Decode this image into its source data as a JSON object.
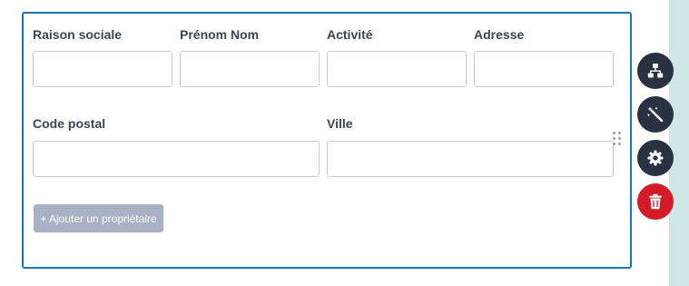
{
  "form": {
    "fields": {
      "raison_sociale": {
        "label": "Raison sociale",
        "value": "",
        "placeholder": ""
      },
      "prenom_nom": {
        "label": "Prénom Nom",
        "value": "",
        "placeholder": ""
      },
      "activite": {
        "label": "Activité",
        "value": "",
        "placeholder": ""
      },
      "adresse": {
        "label": "Adresse",
        "value": "",
        "placeholder": ""
      },
      "code_postal": {
        "label": "Code postal",
        "value": "",
        "placeholder": ""
      },
      "ville": {
        "label": "Ville",
        "value": "",
        "placeholder": ""
      }
    },
    "add_owner_label": "+ Ajouter un propriétaire"
  },
  "toolbar": {
    "icons": [
      "sitemap-icon",
      "magic-wand-icon",
      "gear-icon",
      "trash-icon"
    ]
  },
  "colors": {
    "card_border": "#1877b6",
    "add_button_bg": "#a8b2c4",
    "tool_button_bg": "#283241",
    "delete_button_bg": "#d21b26",
    "side_strip": "#cfe7e7"
  }
}
